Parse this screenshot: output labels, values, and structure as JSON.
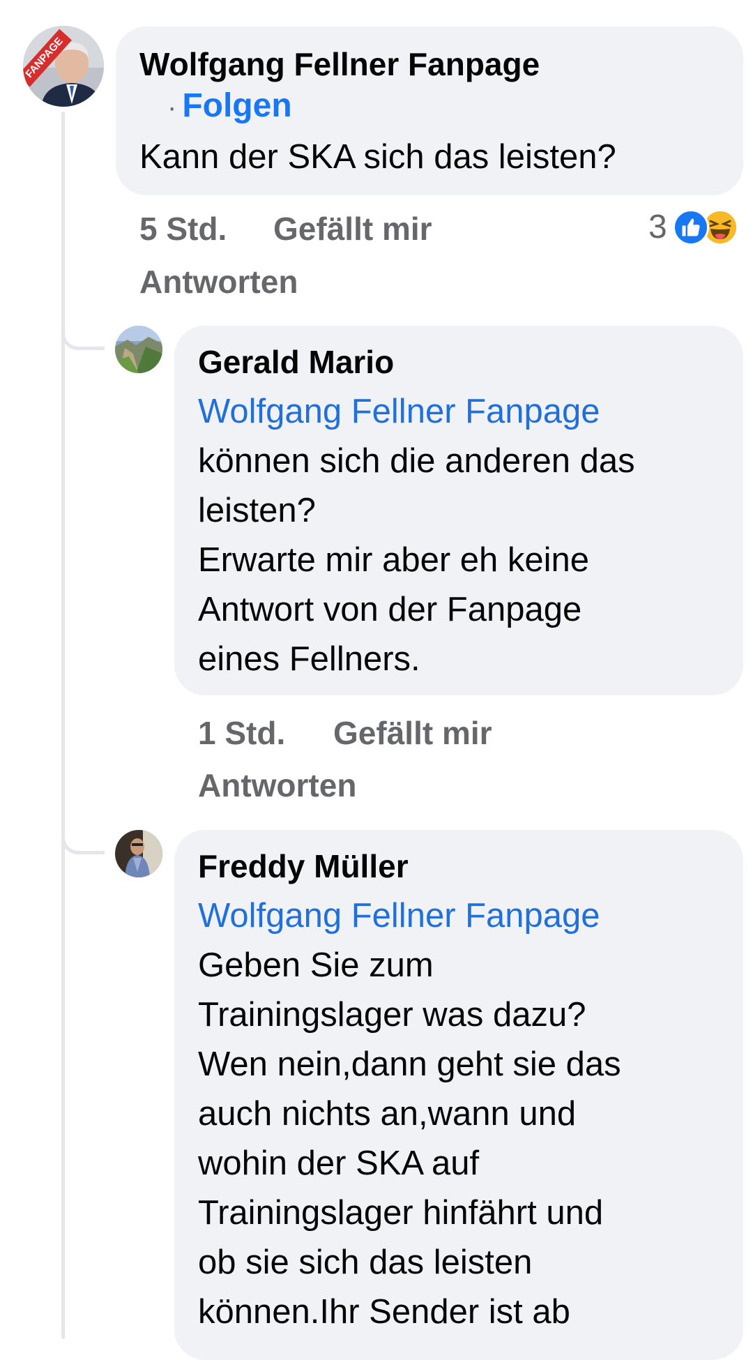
{
  "comment": {
    "author": "Wolfgang Fellner Fanpage",
    "follow_label": "Folgen",
    "follow_dot": "·",
    "text": "Kann der SKA sich das leisten?",
    "time": "5 Std.",
    "like_label": "Gefällt mir",
    "reply_label": "Antworten",
    "reaction_count": "3",
    "reactions": [
      "like-icon",
      "haha-icon"
    ],
    "avatar_badge": "FANPAGE"
  },
  "replies": [
    {
      "author": "Gerald Mario",
      "mention": "Wolfgang Fellner Fanpage",
      "text": "können sich die anderen das\nleisten?\nErwarte mir aber eh keine\nAntwort von der Fanpage\neines Fellners.",
      "time": "1 Std.",
      "like_label": "Gefällt mir",
      "reply_label": "Antworten"
    },
    {
      "author": "Freddy Müller",
      "mention": "Wolfgang Fellner Fanpage",
      "text": "Geben Sie zum\nTrainingslager was dazu?\nWen nein,dann geht sie das\nauch nichts an,wann und\nwohin der SKA auf\nTrainingslager hinfährt und\nob sie sich das leisten\nkönnen.Ihr Sender ist ab"
    }
  ],
  "colors": {
    "bubble": "#f0f2f5",
    "link": "#216fdb",
    "follow": "#1877f2",
    "meta": "#65676b"
  }
}
